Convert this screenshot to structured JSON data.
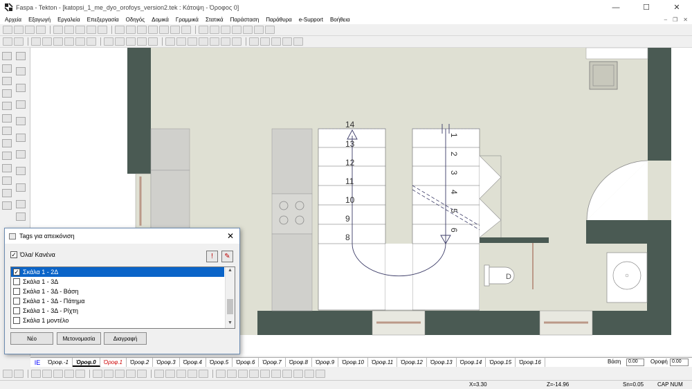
{
  "window": {
    "title": "Faspa - Tekton - [katopsi_1_me_dyo_orofoys_version2.tek : Κάτοψη - Όροφος 0]",
    "controls": {
      "minimize": "—",
      "maximize": "☐",
      "close": "✕"
    }
  },
  "menu": [
    "Αρχεία",
    "Εξαγωγή",
    "Εργαλεία",
    "Επεξεργασία",
    "Οδηγός",
    "Δομικά",
    "Γραμμικά",
    "Στατικά",
    "Παράσταση",
    "Παράθυρα",
    "e-Support",
    "Βοήθεια"
  ],
  "mdi": {
    "minimize": "–",
    "restore": "❐",
    "close": "✕"
  },
  "icons": {
    "app": "tekton-logo-icon",
    "toolbar": [
      "new-file-icon",
      "open-folder-icon",
      "save-icon",
      "print-icon",
      "cut-icon",
      "copy-icon",
      "paste-icon",
      "grid-icon",
      "snap-icon",
      "line-icon",
      "circle-icon",
      "hatch-icon",
      "dimension-icon",
      "text-icon",
      "tools-icon"
    ],
    "left": [
      "wall-icon",
      "door-icon",
      "window-icon",
      "stair-icon",
      "column-icon",
      "beam-icon",
      "slab-icon",
      "roof-icon",
      "furniture-icon",
      "text-icon",
      "level-icon",
      "section-icon",
      "camera-icon",
      "light-icon",
      "eraser-icon"
    ]
  },
  "drawing": {
    "stair_left_numbers": [
      "14",
      "13",
      "12",
      "11",
      "10",
      "9",
      "8"
    ],
    "stair_right_numbers": [
      "1",
      "2",
      "3",
      "4",
      "5",
      "6"
    ],
    "toilet_letter": "D",
    "colors": {
      "floor": "#dfe0d3",
      "wall": "#4a5a53",
      "line": "#3a3a66"
    }
  },
  "dialog": {
    "title": "Tags για απεικόνιση",
    "all_none": "Όλα/ Κανένα",
    "items": [
      {
        "label": "Σκάλα 1 - 2Δ",
        "checked": true,
        "selected": true
      },
      {
        "label": "Σκάλα 1 - 3Δ",
        "checked": false,
        "selected": false
      },
      {
        "label": "Σκάλα 1 - 3Δ - Βάση",
        "checked": false,
        "selected": false
      },
      {
        "label": "Σκάλα 1 - 3Δ - Πάτημα",
        "checked": false,
        "selected": false
      },
      {
        "label": "Σκάλα 1 - 3Δ - Ρίχτη",
        "checked": false,
        "selected": false
      },
      {
        "label": "Σκάλα 1 μοντέλο",
        "checked": false,
        "selected": false
      }
    ],
    "buttons": {
      "new": "Νέο",
      "rename": "Μετονομασία",
      "delete": "Διαγραφή"
    },
    "close": "✕"
  },
  "floors": {
    "lead": "IE",
    "tabs": [
      "Όροφ.-1",
      "Όροφ.0",
      "Όροφ.1",
      "Όροφ.2",
      "Όροφ.3",
      "Όροφ.4",
      "Όροφ.5",
      "Όροφ.6",
      "Όροφ.7",
      "Όροφ.8",
      "Όροφ.9",
      "Όροφ.10",
      "Όροφ.11",
      "Όροφ.12",
      "Όροφ.13",
      "Όροφ.14",
      "Όροφ.15",
      "Όροφ.16"
    ],
    "active": "Όροφ.0",
    "red": "Όροφ.1",
    "basis_label": "Βάση",
    "basis_value": "0.00",
    "ceiling_label": "Οροφή",
    "ceiling_value": "0.00"
  },
  "status": {
    "x": "X=3.30",
    "z": "Z=-14.96",
    "sn": "Sn=0.05",
    "keys": "CAP NUM"
  }
}
